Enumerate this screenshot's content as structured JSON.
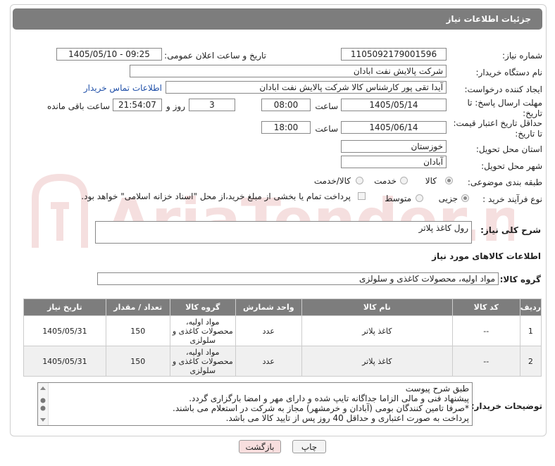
{
  "header": {
    "title": "جزئیات اطلاعات نیاز"
  },
  "watermark": {
    "text": "AriaTender.neT"
  },
  "fields": {
    "need_number_label": "شماره نیاز:",
    "need_number": "1105092179001596",
    "announce_label": "تاریخ و ساعت اعلان عمومی:",
    "announce_value": "1405/05/10 - 09:25",
    "buyer_org_label": "نام دستگاه خریدار:",
    "buyer_org": "شرکت پالایش نفت ابادان",
    "creator_label": "ایجاد کننده درخواست:",
    "creator": "آیدا تقی پور کارشناس کالا شرکت پالایش نفت ابادان",
    "contact_link": "اطلاعات تماس خریدار",
    "deadline_label_1": "مهلت ارسال پاسخ: تا",
    "deadline_label_2": "تاریخ:",
    "deadline_date": "1405/05/14",
    "time_label": "ساعت",
    "deadline_time": "08:00",
    "days_value": "3",
    "days_label": "روز و",
    "remaining_time": "21:54:07",
    "remaining_label": "ساعت باقی مانده",
    "validity_label_1": "حداقل تاریخ اعتبار قیمت:",
    "validity_label_2": "تا تاریخ:",
    "validity_date": "1405/06/14",
    "validity_time": "18:00",
    "province_label": "استان محل تحویل:",
    "province": "خوزستان",
    "city_label": "شهر محل تحویل:",
    "city": "آبادان",
    "category_label": "طبقه بندی موضوعی:",
    "category_options": [
      "کالا",
      "خدمت",
      "کالا/خدمت"
    ],
    "category_selected": "کالا",
    "process_label": "نوع فرآیند خرید :",
    "process_options": [
      "جزیی",
      "متوسط"
    ],
    "process_selected": "جزیی",
    "payment_note": "پرداخت تمام یا بخشی از مبلغ خرید،از محل \"اسناد خزانه اسلامی\" خواهد بود."
  },
  "summary": {
    "label": "شرح کلی نیاز:",
    "value": "رول کاغذ پلاتر"
  },
  "goods_section": {
    "title": "اطلاعات کالاهای مورد نیاز"
  },
  "goods_group": {
    "label": "گروه کالا:",
    "value": "مواد اولیه، محصولات کاغذی و سلولزی"
  },
  "table": {
    "headers": [
      "ردیف",
      "کد کالا",
      "نام کالا",
      "واحد شمارش",
      "گروه کالا",
      "تعداد / مقدار",
      "تاریخ نیاز"
    ],
    "rows": [
      {
        "row": "1",
        "code": "--",
        "name": "کاغذ پلاتر",
        "unit": "عدد",
        "group": "مواد اولیه، محصولات کاغذی و سلولزی",
        "qty": "150",
        "date": "1405/05/31"
      },
      {
        "row": "2",
        "code": "--",
        "name": "کاغذ پلاتر",
        "unit": "عدد",
        "group": "مواد اولیه، محصولات کاغذی و سلولزی",
        "qty": "150",
        "date": "1405/05/31"
      }
    ]
  },
  "notes": {
    "label": "توضیحات خریدار:",
    "lines": [
      "طبق شرح پیوست",
      "پیشنهاد فنی و مالی الزاما جداگانه تایپ شده و دارای مهر و امضا بارگزاری گردد.",
      "*صرفا تامین کنندگان بومی (آبادان و خرمشهر) مجاز به شرکت در استعلام می باشند.",
      "پرداخت به صورت اعتباری و حداقل 40 روز پس از تایید کالا می باشد."
    ]
  },
  "buttons": {
    "print": "چاپ",
    "back": "بازگشت"
  },
  "colors": {
    "header_bg": "#7d7d7d",
    "link": "#1f4fa8",
    "back_button_bg": "#f8dede"
  }
}
